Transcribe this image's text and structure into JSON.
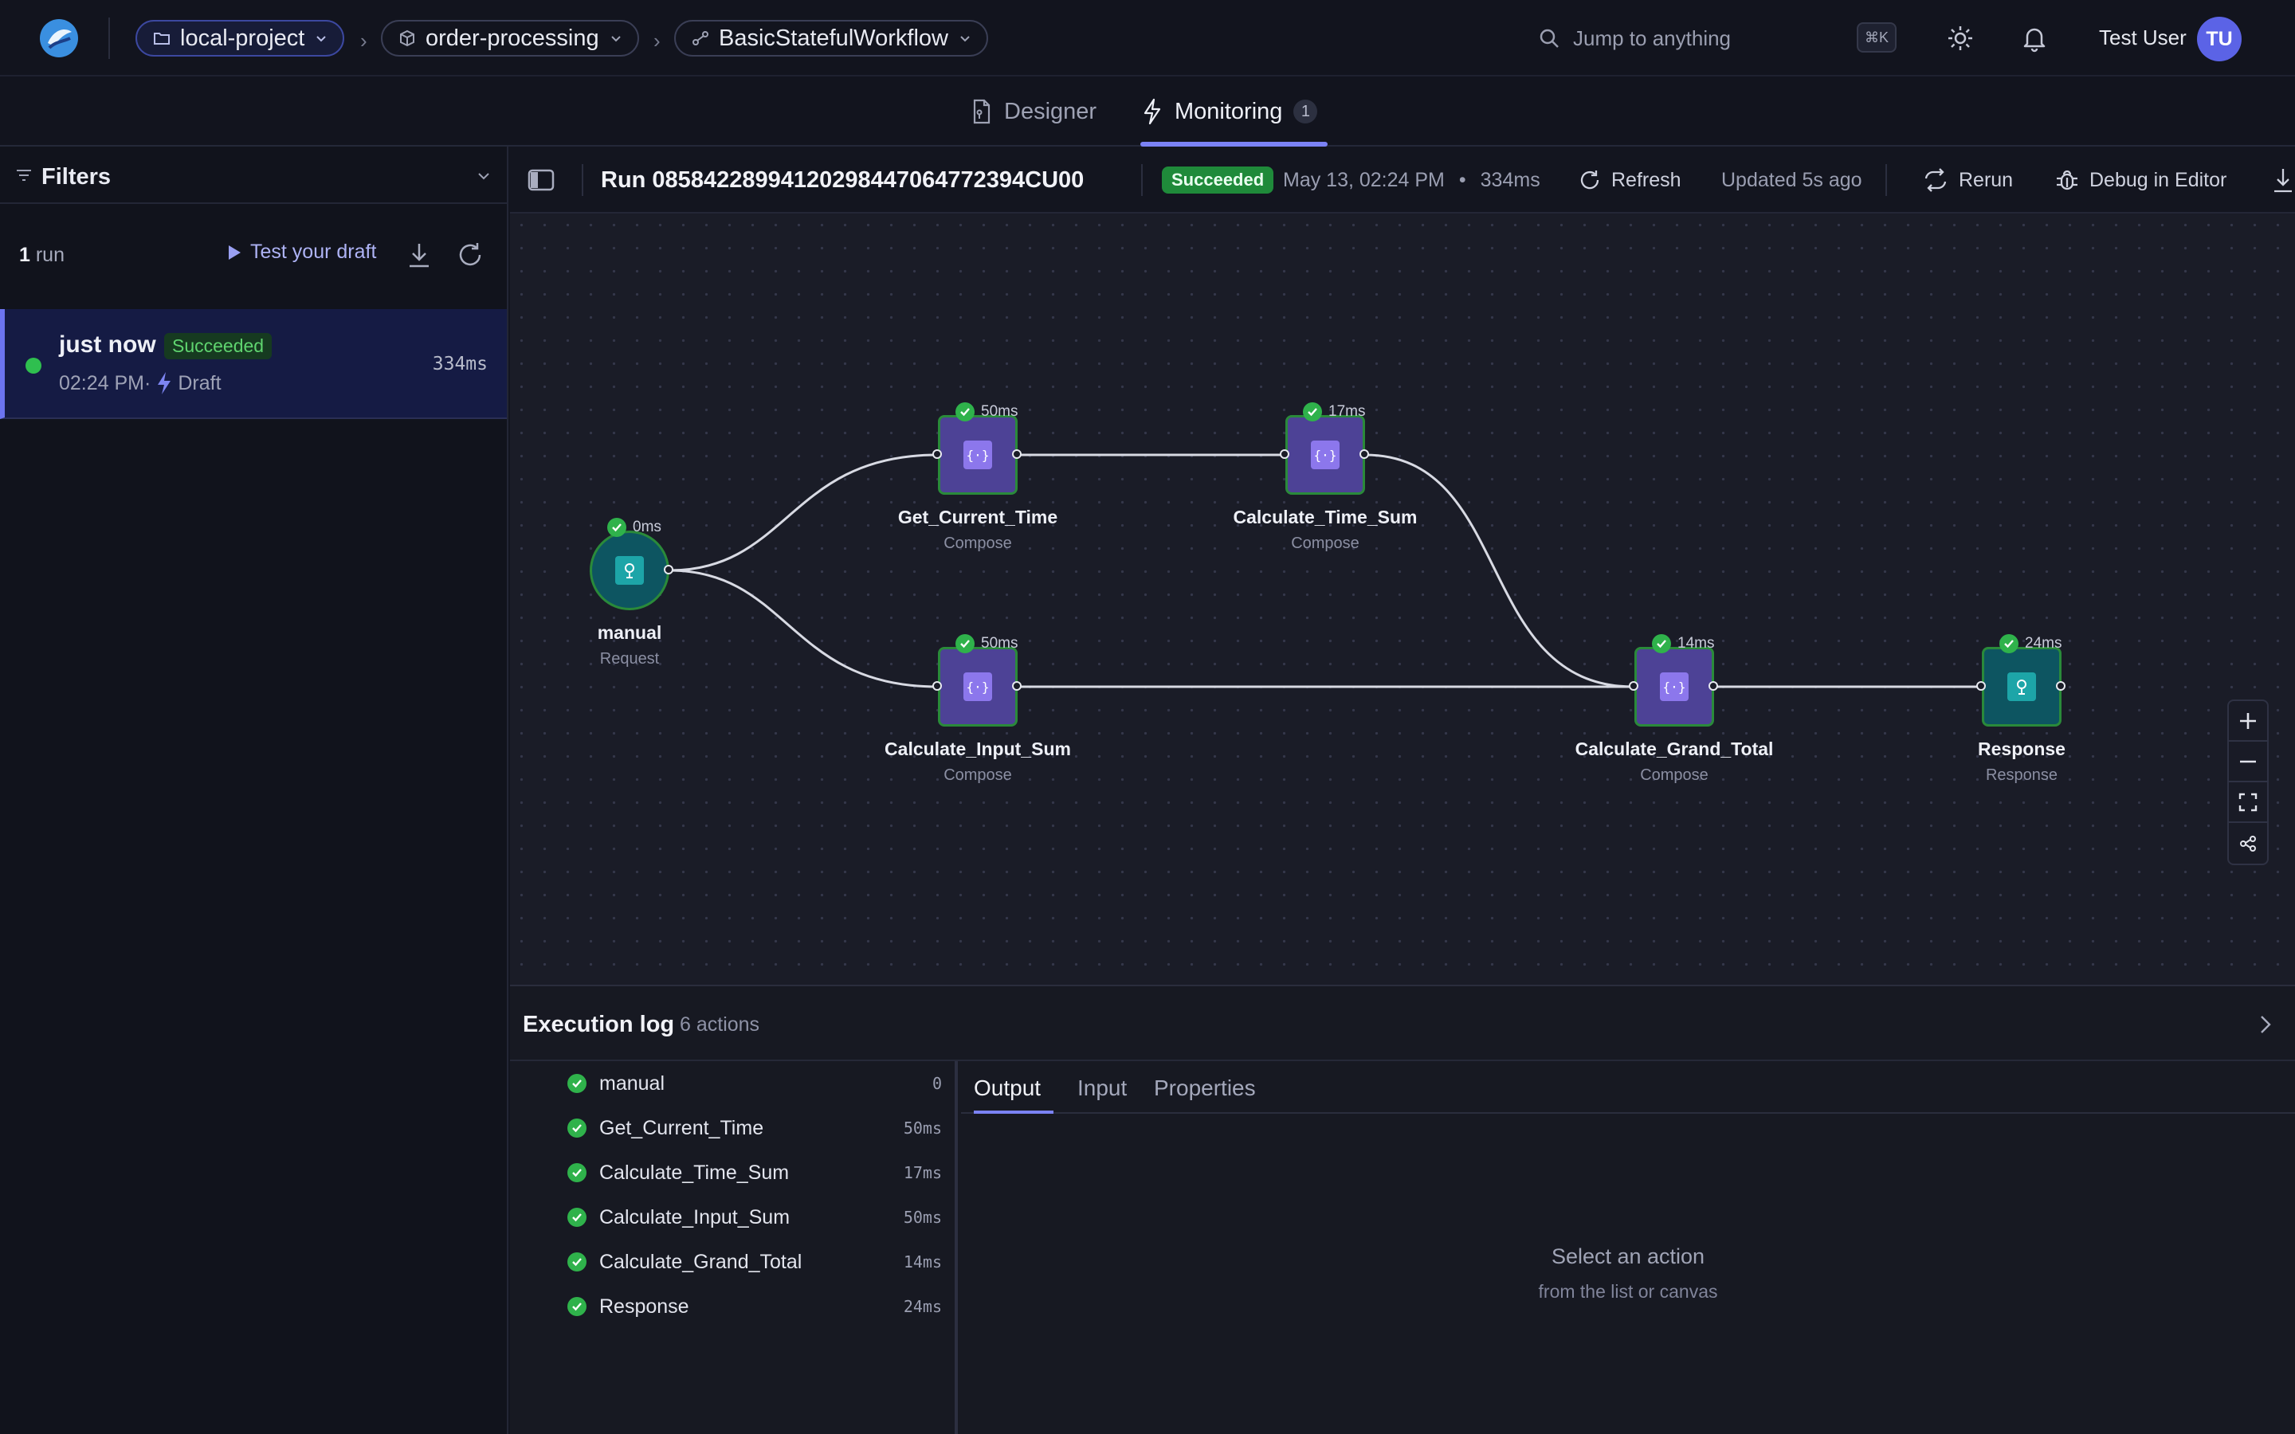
{
  "header": {
    "breadcrumbs": [
      {
        "label": "local-project",
        "icon": "folder-icon"
      },
      {
        "label": "order-processing",
        "icon": "cube-icon"
      },
      {
        "label": "BasicStatefulWorkflow",
        "icon": "workflow-icon"
      }
    ],
    "search_placeholder": "Jump to anything",
    "shortcut": "⌘K",
    "user_name": "Test User",
    "avatar_initials": "TU"
  },
  "tabs": {
    "designer": "Designer",
    "monitoring": "Monitoring",
    "monitoring_count": "1"
  },
  "sidebar": {
    "filters_label": "Filters",
    "run_count": "1",
    "run_count_suffix": "run",
    "test_draft_label": "Test your draft",
    "runs": [
      {
        "title": "just now",
        "status": "Succeeded",
        "time": "02:24 PM·",
        "version": "Draft",
        "duration": "334ms"
      }
    ]
  },
  "run": {
    "id": "Run 08584228994120298447064772394CU00",
    "status": "Succeeded",
    "date": "May 13, 02:24 PM",
    "dot": "•",
    "duration": "334ms",
    "refresh_label": "Refresh",
    "updated": "Updated 5s ago",
    "rerun_label": "Rerun",
    "debug_label": "Debug in Editor"
  },
  "canvas": {
    "nodes": [
      {
        "name": "manual",
        "type": "Request",
        "timing": "0ms",
        "icon": "request-icon"
      },
      {
        "name": "Get_Current_Time",
        "type": "Compose",
        "timing": "50ms",
        "icon": "compose-icon"
      },
      {
        "name": "Calculate_Time_Sum",
        "type": "Compose",
        "timing": "17ms",
        "icon": "compose-icon"
      },
      {
        "name": "Calculate_Input_Sum",
        "type": "Compose",
        "timing": "50ms",
        "icon": "compose-icon"
      },
      {
        "name": "Calculate_Grand_Total",
        "type": "Compose",
        "timing": "14ms",
        "icon": "compose-icon"
      },
      {
        "name": "Response",
        "type": "Response",
        "timing": "24ms",
        "icon": "response-icon"
      }
    ]
  },
  "exec_log": {
    "title": "Execution log",
    "count": "6 actions",
    "actions": [
      {
        "name": "manual",
        "duration": "0"
      },
      {
        "name": "Get_Current_Time",
        "duration": "50ms"
      },
      {
        "name": "Calculate_Time_Sum",
        "duration": "17ms"
      },
      {
        "name": "Calculate_Input_Sum",
        "duration": "50ms"
      },
      {
        "name": "Calculate_Grand_Total",
        "duration": "14ms"
      },
      {
        "name": "Response",
        "duration": "24ms"
      }
    ],
    "detail_tabs": [
      "Output",
      "Input",
      "Properties"
    ],
    "empty_title": "Select an action",
    "empty_subtitle": "from the list or canvas"
  },
  "colors": {
    "accent": "#7b82f5",
    "success": "#2fb24b",
    "compose_node": "#4d4296",
    "teal_node": "#0d5561"
  }
}
